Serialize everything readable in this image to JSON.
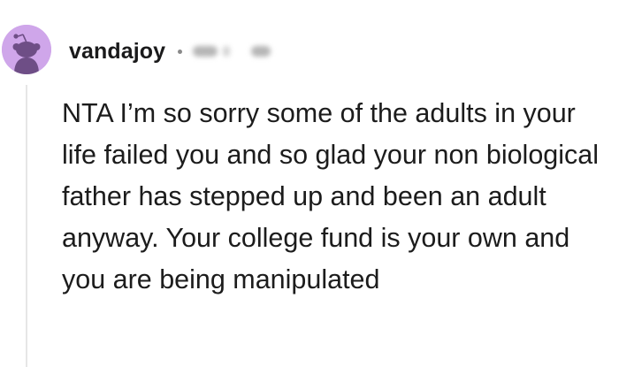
{
  "comment": {
    "author": "vandajoy",
    "avatar_icon": "snoo-avatar-icon",
    "avatar_color": "#cfa6ea",
    "body": "NTA I’m so sorry some of the adults in your life failed you and so glad your non biological father has stepped up and been an adult anyway. Your college fund is your own and you are being manipulated"
  }
}
